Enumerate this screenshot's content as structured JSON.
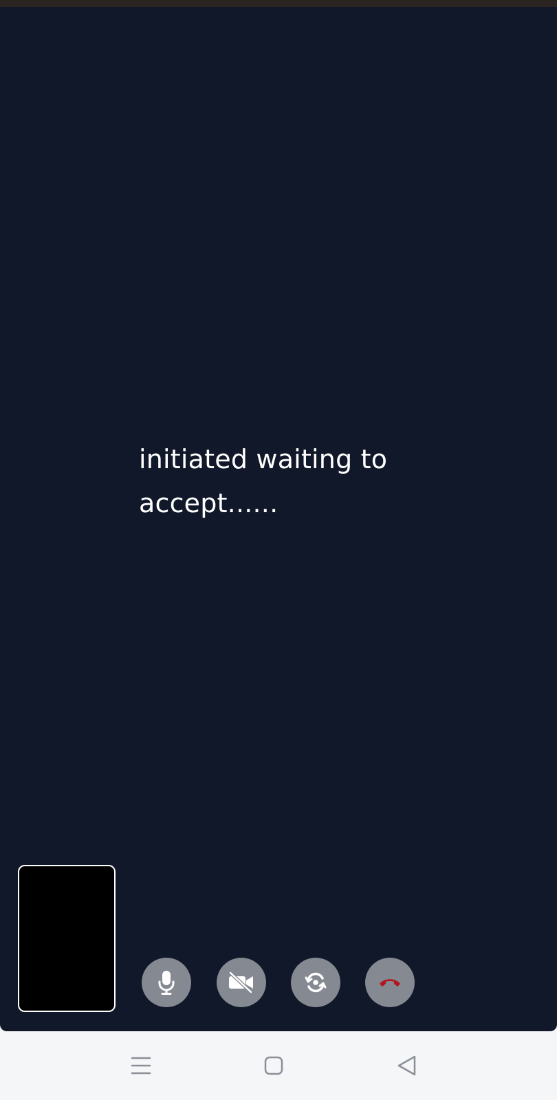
{
  "call": {
    "status_text": "initiated waiting to accept......"
  },
  "controls": [
    {
      "icon": "microphone-icon",
      "label": "mute"
    },
    {
      "icon": "video-off-icon",
      "label": "video"
    },
    {
      "icon": "switch-camera-icon",
      "label": "flip camera"
    },
    {
      "icon": "end-call-icon",
      "label": "end call"
    }
  ],
  "navigation": {
    "menu_icon": "recent-apps-icon",
    "home_icon": "home-icon",
    "back_icon": "back-icon"
  },
  "colors": {
    "call_background": "#111829",
    "control_button": "#858992",
    "end_call_icon": "#b3161f",
    "nav_background": "#f5f6f8",
    "nav_icon": "#8a8f98"
  }
}
